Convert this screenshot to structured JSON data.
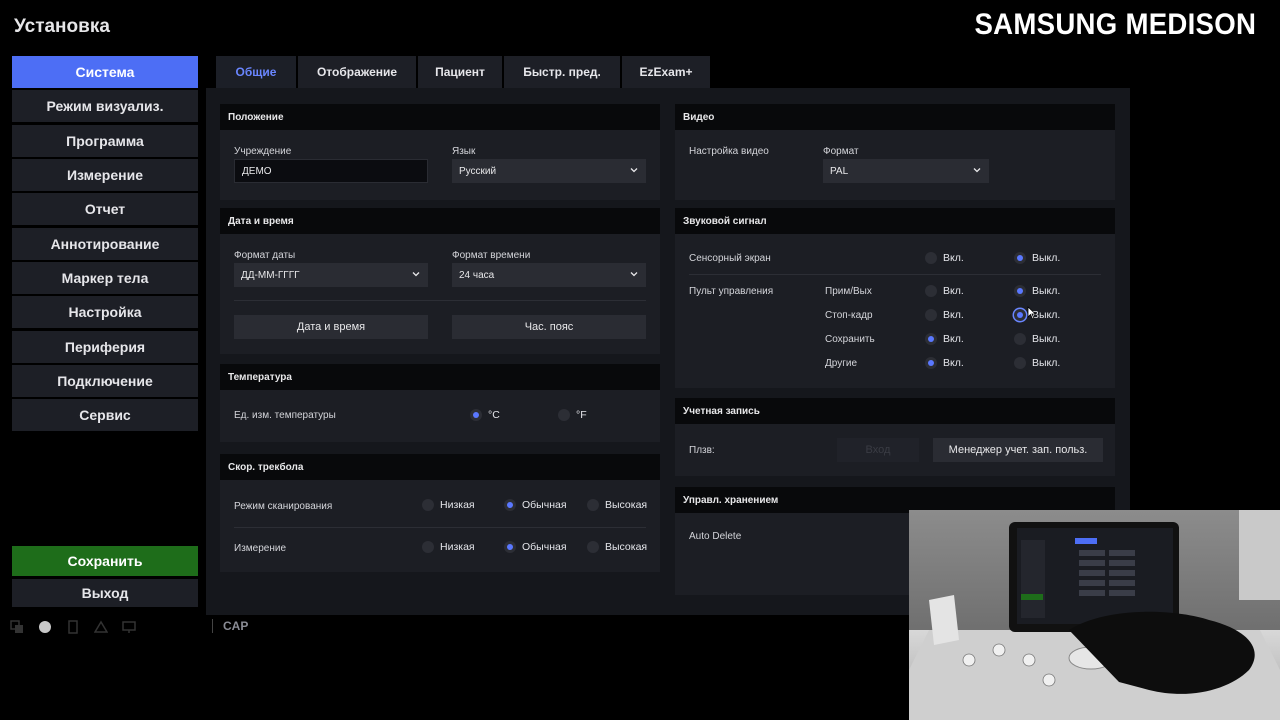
{
  "app": {
    "title": "Установка",
    "brand": "SAMSUNG MEDISON"
  },
  "sidebar": {
    "items": [
      {
        "label": "Система"
      },
      {
        "label": "Режим визуализ."
      },
      {
        "label": "Программа"
      },
      {
        "label": "Измерение"
      },
      {
        "label": "Отчет"
      },
      {
        "label": "Аннотирование"
      },
      {
        "label": "Маркер тела"
      },
      {
        "label": "Настройка"
      },
      {
        "label": "Периферия"
      },
      {
        "label": "Подключение"
      },
      {
        "label": "Сервис"
      }
    ],
    "active_index": 0,
    "save_label": "Сохранить",
    "exit_label": "Выход"
  },
  "status": {
    "cap_label": "CAP"
  },
  "tabs": [
    {
      "label": "Общие"
    },
    {
      "label": "Отображение"
    },
    {
      "label": "Пациент"
    },
    {
      "label": "Быстр. пред."
    },
    {
      "label": "EzExam+"
    }
  ],
  "position": {
    "header": "Положение",
    "institution_label": "Учреждение",
    "institution_value": "ДЕМО",
    "language_label": "Язык",
    "language_value": "Русский"
  },
  "datetime": {
    "header": "Дата и время",
    "date_format_label": "Формат даты",
    "date_format_value": "ДД-ММ-ГГГГ",
    "time_format_label": "Формат времени",
    "time_format_value": "24 часа",
    "datetime_button": "Дата и время",
    "timezone_button": "Час. пояс"
  },
  "temperature": {
    "header": "Температура",
    "unit_label": "Ед. изм. температуры",
    "celsius": "°C",
    "fahrenheit": "°F",
    "selected": "°C"
  },
  "trackball": {
    "header": "Скор. трекбола",
    "rows": [
      {
        "label": "Режим сканирования",
        "low": "Низкая",
        "normal": "Обычная",
        "high": "Высокая",
        "selected": "normal"
      },
      {
        "label": "Измерение",
        "low": "Низкая",
        "normal": "Обычная",
        "high": "Высокая",
        "selected": "normal"
      }
    ]
  },
  "video": {
    "header": "Видео",
    "setting_label": "Настройка видео",
    "format_label": "Формат",
    "format_value": "PAL"
  },
  "beep": {
    "header": "Звуковой сигнал",
    "touchscreen_label": "Сенсорный экран",
    "controls_label": "Пульт управления",
    "on_label": "Вкл.",
    "off_label": "Выкл.",
    "touchscreen_selected": "off",
    "controls": [
      {
        "label": "Прим/Вых",
        "selected": "off"
      },
      {
        "label": "Стоп-кадр",
        "selected": "off"
      },
      {
        "label": "Сохранить",
        "selected": "on"
      },
      {
        "label": "Другие",
        "selected": "on"
      }
    ]
  },
  "account": {
    "header": "Учетная запись",
    "user_label": "Плзв:",
    "login_button": "Вход",
    "manager_button": "Менеджер учет. зап. польз."
  },
  "storage": {
    "header": "Управл. хранением",
    "auto_delete_label": "Auto Delete"
  },
  "colors": {
    "accent": "#4d6ef5",
    "save": "#1e6d1a",
    "radio_on": "#5a78ff"
  }
}
